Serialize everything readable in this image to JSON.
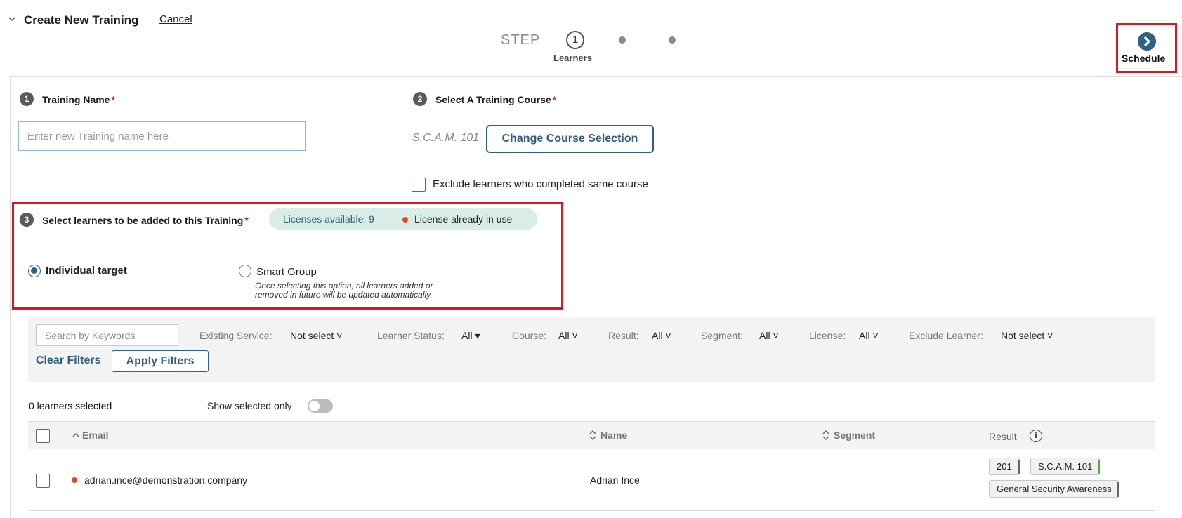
{
  "header": {
    "title": "Create New Training",
    "cancel_label": "Cancel"
  },
  "stepper": {
    "step_word": "STEP",
    "current_step": "1",
    "current_label": "Learners",
    "next_label": "Schedule"
  },
  "section1": {
    "number": "1",
    "label": "Training Name",
    "required_mark": "*",
    "input_placeholder": "Enter new Training name here",
    "input_value": ""
  },
  "section2": {
    "number": "2",
    "label": "Select A Training Course",
    "required_mark": "*",
    "course_name": "S.C.A.M. 101",
    "change_button": "Change Course Selection",
    "exclude_label": "Exclude learners who completed same course",
    "exclude_checked": false
  },
  "section3": {
    "number": "3",
    "label": "Select learners to be added to this Training",
    "required_mark": "*",
    "licenses_available": "Licenses available: 9",
    "license_in_use": "License already in use",
    "option_individual": "Individual target",
    "option_smart": "Smart Group",
    "smart_help_line1": "Once selecting this option, all learners added or",
    "smart_help_line2": "removed in future will be updated automatically.",
    "selected_option": "Individual target"
  },
  "filters": {
    "search_placeholder": "Search by Keywords",
    "existing_service_label": "Existing Service:",
    "existing_service_value": "Not select",
    "learner_status_label": "Learner Status:",
    "learner_status_value": "All",
    "course_label": "Course:",
    "course_value": "All",
    "result_label": "Result:",
    "result_value": "All",
    "segment_label": "Segment:",
    "segment_value": "All",
    "license_label": "License:",
    "license_value": "All",
    "exclude_label": "Exclude Learner:",
    "exclude_value": "Not select",
    "clear_label": "Clear Filters",
    "apply_label": "Apply Filters"
  },
  "selection": {
    "count_text": "0 learners selected",
    "show_selected_label": "Show selected only",
    "show_selected_on": false
  },
  "table": {
    "columns": {
      "email": "Email",
      "name": "Name",
      "segment": "Segment",
      "result": "Result"
    },
    "rows": [
      {
        "email": "adrian.ince@demonstration.company",
        "name": "Adrian Ince",
        "segment": "",
        "result_tags": [
          "201",
          "S.C.A.M. 101",
          "General Security Awareness"
        ]
      }
    ]
  },
  "colors": {
    "accent": "#2f5f86",
    "highlight_border": "#e0141e",
    "license_pill_bg": "#d8ede6",
    "in_use_dot": "#e0472a",
    "tag_bar_green": "#4caf3d",
    "tag_bar_gray": "#666666"
  },
  "icons": {
    "collapse": "chevron-down-icon",
    "schedule": "chevron-right-circle-icon",
    "sort_up": "chevron-up-icon",
    "sort_both": "sort-arrows-icon",
    "info": "info-icon"
  }
}
